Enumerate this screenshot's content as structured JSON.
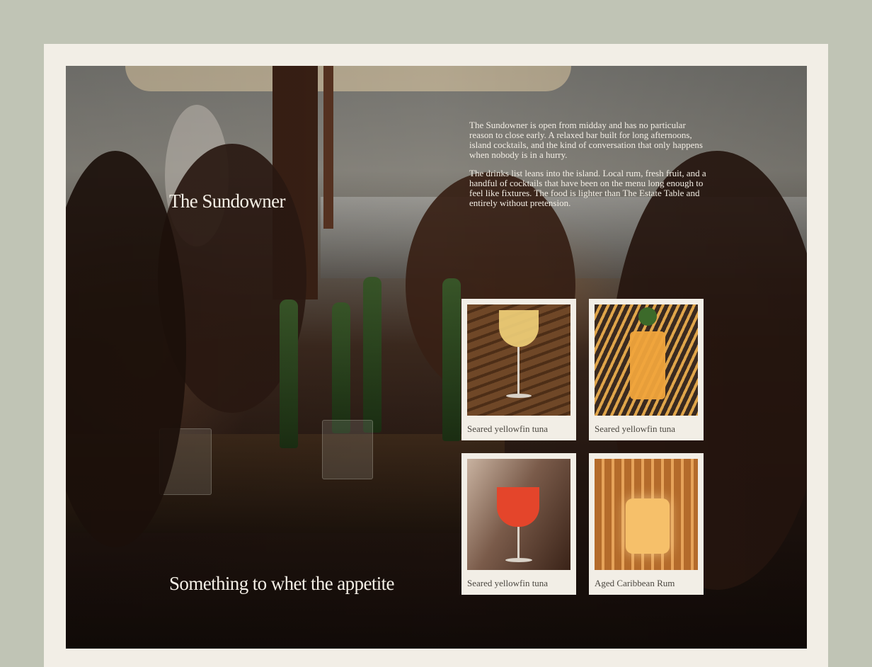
{
  "page": {
    "title": "The Sundowner",
    "subtitle": "Something to whet the appetite"
  },
  "intro": {
    "paragraphs": [
      "The Sundowner is open from midday and has no particular reason to close early. A relaxed bar built for long afternoons, island cocktails, and the kind of conversation that only happens when nobody is in a hurry.",
      "The drinks list leans into the island. Local rum, fresh fruit, and a handful of cocktails that have been on the menu long enough to feel like fixtures. The food is lighter than The Estate Table and entirely without pretension."
    ]
  },
  "gallery": {
    "items": [
      {
        "caption": "Seared yellowfin tuna",
        "drink": "wine-glass",
        "color": "#f2d27a"
      },
      {
        "caption": "Seared yellowfin tuna",
        "drink": "highball",
        "color": "#f0a43c"
      },
      {
        "caption": "Seared yellowfin tuna",
        "drink": "wine-glass",
        "color": "#e4452b"
      },
      {
        "caption": "Aged Caribbean Rum",
        "drink": "tumbler",
        "color": "#f6c06a"
      }
    ]
  },
  "colors": {
    "page_background": "#c0c4b5",
    "frame": "#f2eee6",
    "title_text": "#f4efe6",
    "caption_text": "#4b4740"
  }
}
